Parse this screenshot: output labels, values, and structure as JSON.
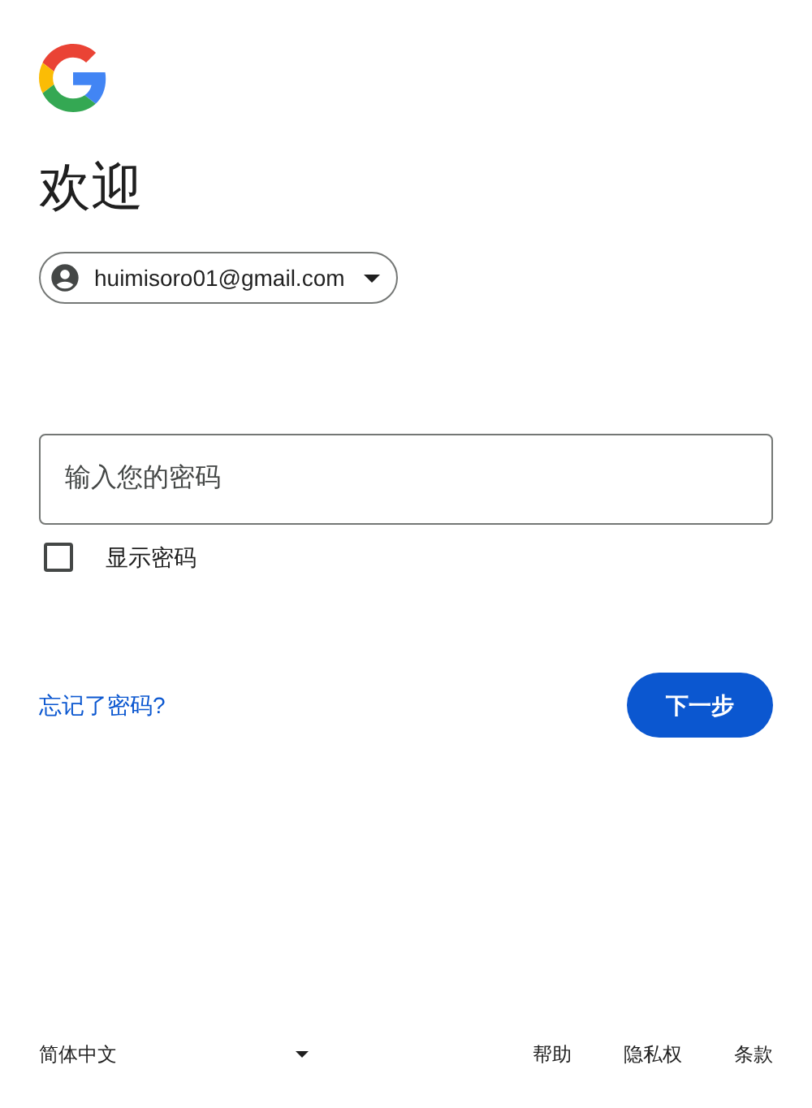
{
  "heading": "欢迎",
  "account": {
    "email": "huimisoro01@gmail.com"
  },
  "password_field": {
    "placeholder": "输入您的密码"
  },
  "show_password": {
    "label": "显示密码",
    "checked": false
  },
  "forgot_link": "忘记了密码?",
  "next_button": "下一步",
  "footer": {
    "language": "简体中文",
    "links": [
      "帮助",
      "隐私权",
      "条款"
    ]
  }
}
